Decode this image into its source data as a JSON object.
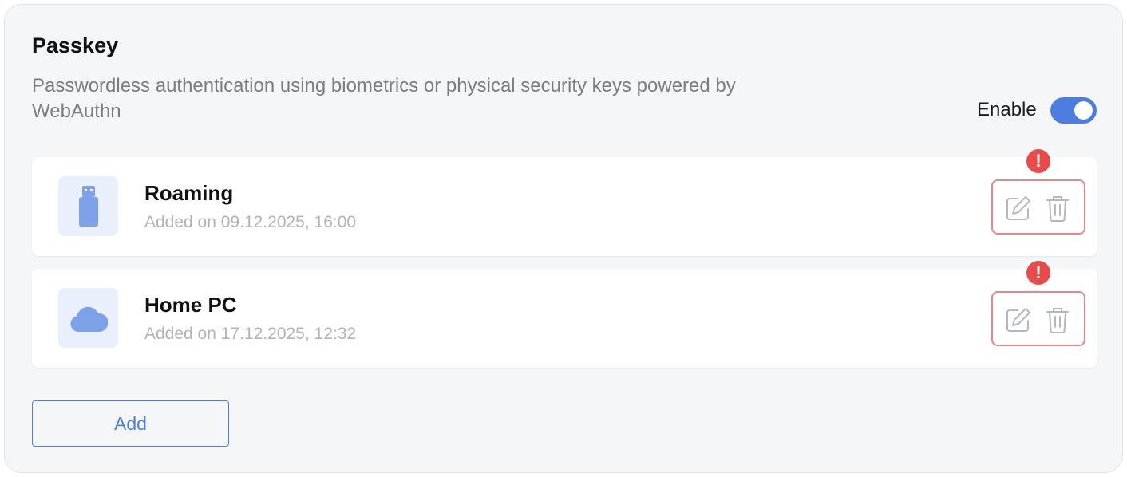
{
  "section": {
    "title": "Passkey",
    "description": "Passwordless authentication using biometrics or physical security keys powered by WebAuthn",
    "enable_label": "Enable",
    "enabled": true
  },
  "passkeys": [
    {
      "name": "Roaming",
      "added": "Added on 09.12.2025, 16:00",
      "icon": "usb-key-icon",
      "alert": "!"
    },
    {
      "name": "Home PC",
      "added": "Added on 17.12.2025, 12:32",
      "icon": "cloud-icon",
      "alert": "!"
    }
  ],
  "add_button": {
    "label": "Add"
  },
  "colors": {
    "accent": "#4b7ee0",
    "alert": "#e94a4a",
    "alert_outline": "#ec8585",
    "icon_fill": "#7ea2ea",
    "icon_bg": "#eaf0fb"
  }
}
